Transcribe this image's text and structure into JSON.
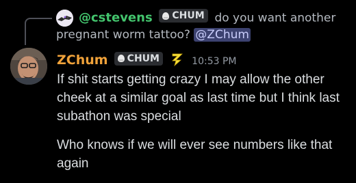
{
  "reply": {
    "username": "@cstevens",
    "tag": "CHUM",
    "text_start": "do you want another",
    "text_end": "pregnant worm tattoo?",
    "mention": "@ZChum"
  },
  "message": {
    "username": "ZChum",
    "tag": "CHUM",
    "badge_icon": "lightning-z-icon",
    "timestamp": "10:53 PM",
    "lines": [
      "If shit starts getting crazy I may allow the other cheek at a similar goal as last time but I think last subathon was special",
      "Who knows if we will ever see numbers like that again"
    ]
  },
  "colors": {
    "background": "#000000",
    "reply_username": "#43c46d",
    "author_username": "#f0a23a",
    "mention_bg": "#3c4270",
    "mention_text": "#c9cdfb"
  }
}
